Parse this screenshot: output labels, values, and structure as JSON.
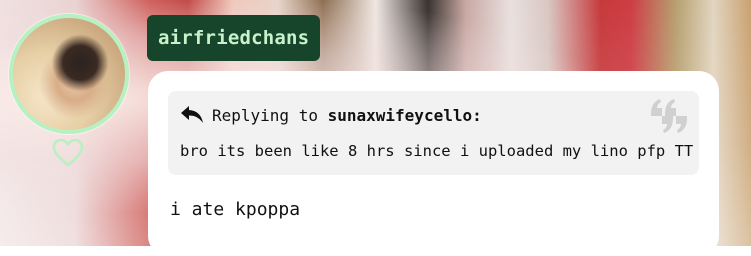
{
  "profile": {
    "username": "airfriedchans"
  },
  "reply": {
    "prefix": "Replying to",
    "to_user": "sunaxwifeycello:",
    "quoted_text": "bro its been like 8 hrs since i uploaded my lino pfp TT"
  },
  "message": {
    "text": "i ate kpoppa"
  },
  "icons": {
    "reply": "reply-arrow-icon",
    "quote": "quote-icon",
    "like": "heart-icon"
  },
  "colors": {
    "username_bg": "#16452b",
    "username_text": "#c9f1cb",
    "avatar_ring": "#b7f0c1",
    "card_bg": "#ffffff",
    "reply_bg": "#f2f2f2"
  }
}
